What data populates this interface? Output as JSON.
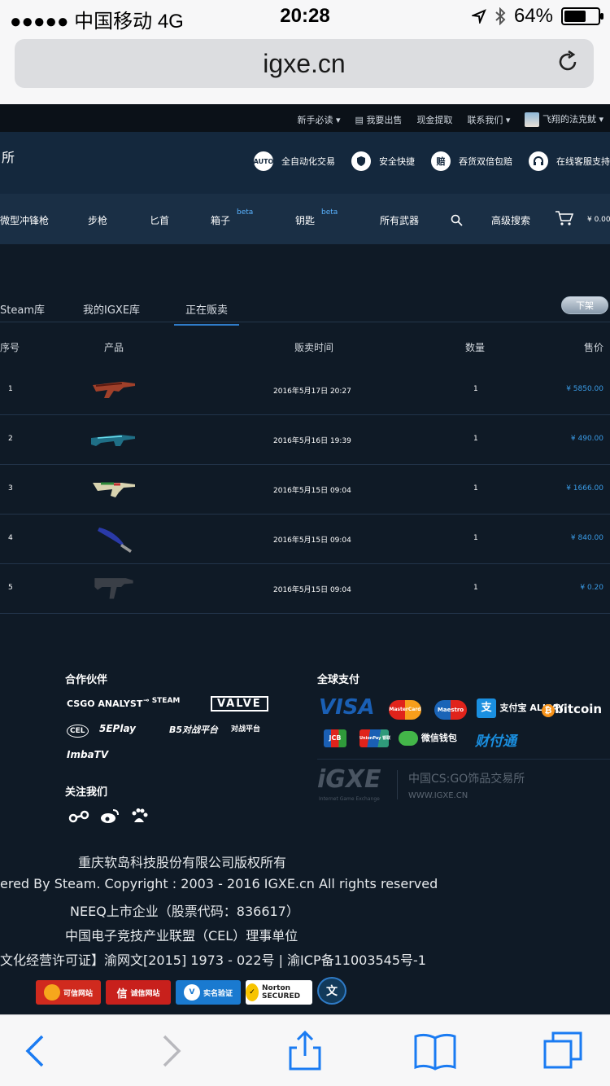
{
  "status_bar": {
    "carrier": "●●●●● 中国移动  4G",
    "time": "20:28",
    "battery": "64%",
    "battery_level": 0.64
  },
  "browser": {
    "url": "igxe.cn"
  },
  "topbar": {
    "items": [
      "新手必读 ▾",
      "我要出售",
      "现金提取",
      "联系我们 ▾",
      "飞翔的法克鱿 ▾"
    ]
  },
  "banner": {
    "brand": "所",
    "features": [
      {
        "icon": "AUTO",
        "label": "全自动化交易"
      },
      {
        "icon": "shield-icon",
        "label": "安全快捷"
      },
      {
        "icon": "赔",
        "label": "吞货双倍包赔"
      },
      {
        "icon": "headset-icon",
        "label": "在线客服支持"
      }
    ]
  },
  "nav": {
    "items": [
      "微型冲锋枪",
      "步枪",
      "匕首",
      "箱子",
      "钥匙",
      "所有武器",
      "高级搜索"
    ],
    "beta": "beta",
    "cart": "¥ 0.00"
  },
  "tabs": {
    "items": [
      "Steam库",
      "我的IGXE库",
      "正在贩卖"
    ],
    "active": 2,
    "action": "下架"
  },
  "table": {
    "headers": [
      "序号",
      "产品",
      "贩卖时间",
      "数量",
      "售价"
    ],
    "rows": [
      {
        "index": "1",
        "time": "2016年5月17日 20:27",
        "qty": "1",
        "price": "¥ 5850.00"
      },
      {
        "index": "2",
        "time": "2016年5月16日 19:39",
        "qty": "1",
        "price": "¥ 490.00"
      },
      {
        "index": "3",
        "time": "2016年5月15日 09:04",
        "qty": "1",
        "price": "¥ 1666.00"
      },
      {
        "index": "4",
        "time": "2016年5月15日 09:04",
        "qty": "1",
        "price": "¥ 840.00"
      },
      {
        "index": "5",
        "time": "2016年5月15日 09:04",
        "qty": "1",
        "price": "¥ 0.20"
      }
    ]
  },
  "footer": {
    "partners_title": "合作伙伴",
    "partners": [
      "CSGO ANALYST",
      "STEAM",
      "VALVE",
      "CEL",
      "5EPlay",
      "B5对战平台",
      "对战平台",
      "ImbaTV"
    ],
    "follow_title": "关注我们",
    "payments_title": "全球支付",
    "payments": [
      "VISA",
      "MasterCard",
      "Maestro",
      "支付宝 ALIPAY",
      "bitcoin",
      "JCB",
      "UnionPay 银联",
      "微信钱包",
      "财付通"
    ],
    "igxe_logo": "iGXE",
    "igxe_sub": "Internet Game Exchange",
    "igxe_slogan": "中国CS:GO饰品交易所",
    "igxe_url": "WWW.IGXE.CN",
    "copyright": [
      "重庆软岛科技股份有限公司版权所有",
      "ered By Steam. Copyright : 2003 - 2016 IGXE.cn All rights reserved",
      "NEEQ上市企业（股票代码：836617）",
      "中国电子竞技产业联盟（CEL）理事单位",
      "文化经营许可证】渝网文[2015] 1973 - 022号 | 渝ICP备11003545号-1"
    ],
    "badges": [
      "可信网站",
      "诚信网站",
      "实名验证",
      "Norton SECURED"
    ]
  },
  "colors": {
    "header": "#14283d",
    "nav": "#1a2f45",
    "page": "#0f1a26",
    "accent": "#3a9be6",
    "ios_blue": "#1a7bf2"
  }
}
